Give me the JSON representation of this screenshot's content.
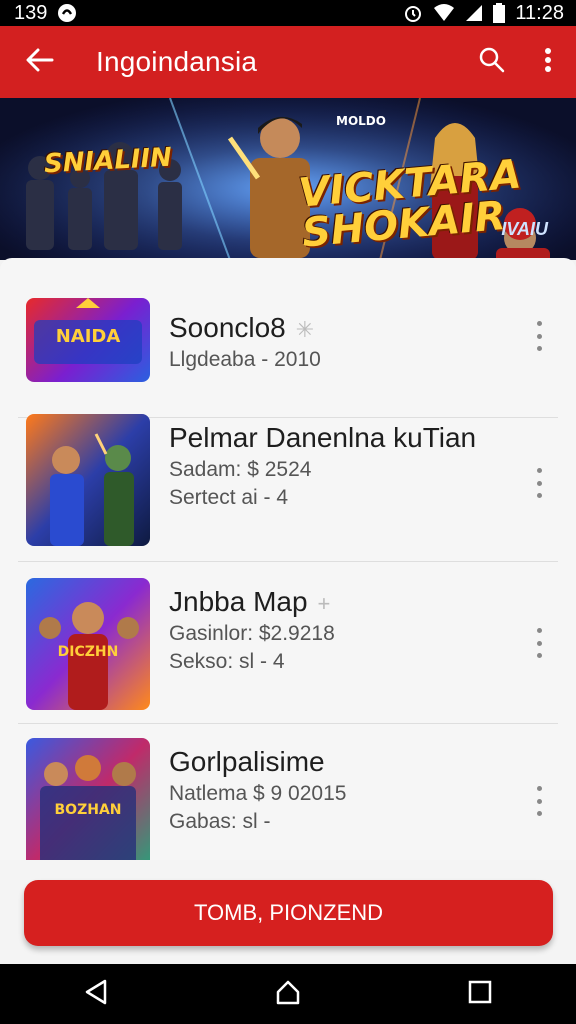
{
  "status_bar": {
    "time_left": "139",
    "time_right": "11:28",
    "icons": [
      "notification-icon",
      "alarm-icon",
      "wifi-icon",
      "signal-icon",
      "battery-icon"
    ]
  },
  "app_bar": {
    "title": "Ingoindansia",
    "color": "#d32020",
    "icons": [
      "back-arrow-icon",
      "search-icon",
      "more-vert-icon"
    ]
  },
  "banner": {
    "title_left": "SNIALIIN",
    "title_main_line1": "VICKTARA",
    "title_main_line2": "SHOKAIR",
    "badge_top": "MOLDO",
    "tag": "IVAIU"
  },
  "list": {
    "items": [
      {
        "title": "Soonclo8",
        "mark": "✳",
        "sub1": "Llgdeaba - 2010",
        "sub2": "",
        "thumb_caption": "NAIDA"
      },
      {
        "title": "Pelmar Danenlna kuTian",
        "mark": "",
        "sub1": "Sadam: $ 2524",
        "sub2": "Sertect ai - 4",
        "thumb_caption": ""
      },
      {
        "title": "Jnbba Map",
        "mark": "+",
        "sub1": "Gasinlor: $2.9218",
        "sub2": "Sekso: sl - 4",
        "thumb_caption": "DICZHN"
      },
      {
        "title": "Gorlpalisime",
        "mark": "",
        "sub1": "Natlema $ 9 02015",
        "sub2": "Gabas: sl -",
        "thumb_caption": "BOZHAN"
      }
    ]
  },
  "primary_button": {
    "label": "TOMB, PIONZEND",
    "color": "#d6201f"
  },
  "nav_bar": {
    "icons": [
      "back-triangle-icon",
      "home-icon",
      "recents-square-icon"
    ]
  }
}
